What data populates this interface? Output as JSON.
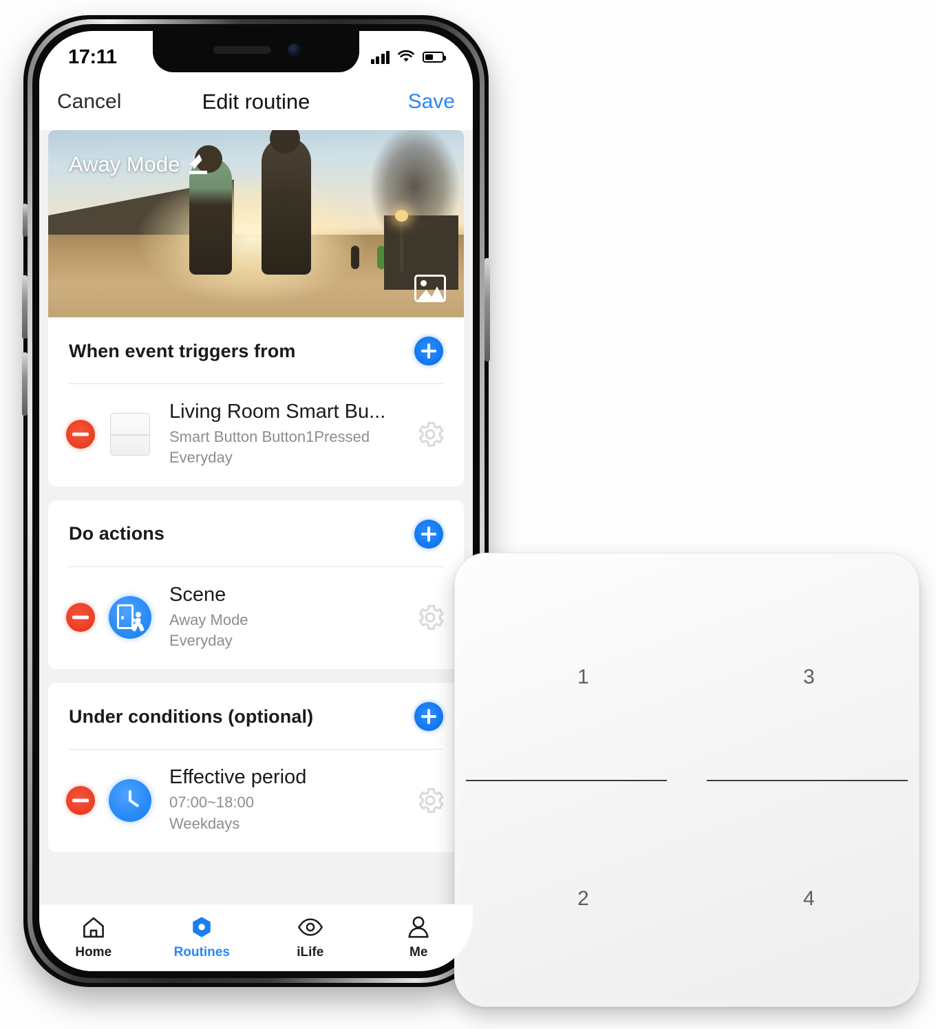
{
  "status_bar": {
    "time": "17:11",
    "signal_icon": "cellular-signal-icon",
    "wifi_icon": "wifi-icon",
    "battery_icon": "battery-icon"
  },
  "nav": {
    "cancel_label": "Cancel",
    "title": "Edit routine",
    "save_label": "Save"
  },
  "hero": {
    "title": "Away Mode",
    "edit_icon": "pencil-icon",
    "photo_icon": "photo-picker-icon"
  },
  "sections": [
    {
      "title": "When event triggers from",
      "add_icon": "plus-icon",
      "rows": [
        {
          "remove_icon": "minus-circle-icon",
          "device_icon": "smart-switch-icon",
          "title": "Living Room Smart Bu...",
          "sub1": "Smart Button Button1Pressed",
          "sub2": "Everyday",
          "settings_icon": "gear-icon"
        }
      ]
    },
    {
      "title": "Do actions",
      "add_icon": "plus-icon",
      "rows": [
        {
          "remove_icon": "minus-circle-icon",
          "device_icon": "scene-exit-door-icon",
          "title": "Scene",
          "sub1": "Away Mode",
          "sub2": "Everyday",
          "settings_icon": "gear-icon"
        }
      ]
    },
    {
      "title": "Under conditions (optional)",
      "add_icon": "plus-icon",
      "rows": [
        {
          "remove_icon": "minus-circle-icon",
          "device_icon": "clock-icon",
          "title": "Effective period",
          "sub1": "07:00~18:00",
          "sub2": "Weekdays",
          "settings_icon": "gear-icon"
        }
      ]
    }
  ],
  "tabbar": {
    "items": [
      {
        "label": "Home",
        "icon": "home-icon",
        "active": false
      },
      {
        "label": "Routines",
        "icon": "hexagon-routines-icon",
        "active": true
      },
      {
        "label": "iLife",
        "icon": "eye-icon",
        "active": false
      },
      {
        "label": "Me",
        "icon": "person-icon",
        "active": false
      }
    ]
  },
  "device": {
    "name": "smart-switch-4-button",
    "buttons": [
      "1",
      "3",
      "2",
      "4"
    ]
  },
  "colors": {
    "accent_blue": "#2a86f5",
    "remove_red": "#ec4026",
    "text_primary": "#1a1a1a",
    "text_secondary": "#8d8d8d",
    "app_background": "#f2f2f2"
  }
}
